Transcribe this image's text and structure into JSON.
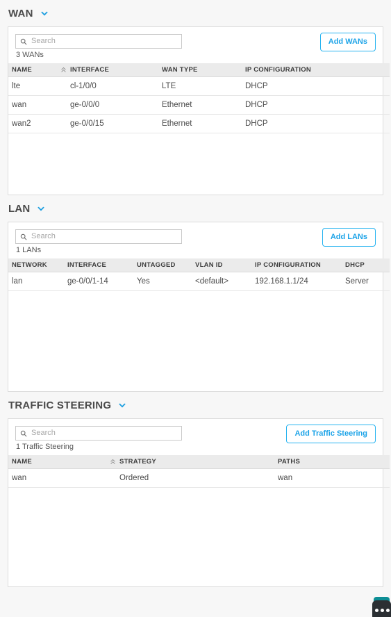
{
  "theme": {
    "accent": "#1ba3e8",
    "page_bg": "#f7f7f7",
    "card_bg": "#ffffff",
    "header_row_bg": "#ebebeb",
    "text": "#4a4a4a"
  },
  "sections": [
    {
      "key": "wan",
      "title": "WAN",
      "collapse_icon": "chevron-down-icon",
      "search": {
        "placeholder": "Search",
        "value": "",
        "icon": "search-icon"
      },
      "count_label": "3 WANs",
      "add_button": "Add WANs",
      "columns": [
        {
          "label": "NAME",
          "sorted": true,
          "sort_icon": "sort-ascending-icon"
        },
        {
          "label": "INTERFACE",
          "sorted": false
        },
        {
          "label": "WAN TYPE",
          "sorted": false
        },
        {
          "label": "IP CONFIGURATION",
          "sorted": false
        }
      ],
      "rows": [
        [
          "lte",
          "cl-1/0/0",
          "LTE",
          "DHCP"
        ],
        [
          "wan",
          "ge-0/0/0",
          "Ethernet",
          "DHCP"
        ],
        [
          "wan2",
          "ge-0/0/15",
          "Ethernet",
          "DHCP"
        ]
      ]
    },
    {
      "key": "lan",
      "title": "LAN",
      "collapse_icon": "chevron-down-icon",
      "search": {
        "placeholder": "Search",
        "value": "",
        "icon": "search-icon"
      },
      "count_label": "1 LANs",
      "add_button": "Add LANs",
      "columns": [
        {
          "label": "NETWORK",
          "sorted": false
        },
        {
          "label": "INTERFACE",
          "sorted": false
        },
        {
          "label": "UNTAGGED",
          "sorted": false
        },
        {
          "label": "VLAN ID",
          "sorted": false
        },
        {
          "label": "IP CONFIGURATION",
          "sorted": false
        },
        {
          "label": "DHCP",
          "sorted": false
        }
      ],
      "rows": [
        [
          "lan",
          "ge-0/0/1-14",
          "Yes",
          "<default>",
          "192.168.1.1/24",
          "Server"
        ]
      ]
    },
    {
      "key": "traffic_steering",
      "title": "TRAFFIC STEERING",
      "collapse_icon": "chevron-down-icon",
      "search": {
        "placeholder": "Search",
        "value": "",
        "icon": "search-icon"
      },
      "count_label": "1 Traffic Steering",
      "add_button": "Add Traffic Steering",
      "columns": [
        {
          "label": "NAME",
          "sorted": false
        },
        {
          "label": "STRATEGY",
          "sorted": true,
          "sort_icon": "sort-ascending-icon"
        },
        {
          "label": "PATHS",
          "sorted": false
        }
      ],
      "rows": [
        [
          "wan",
          "Ordered",
          "wan"
        ]
      ]
    }
  ],
  "chat_widget": {
    "name": "support-chat-widget",
    "cap_color": "#0d8e95",
    "body_color": "#2b2f33"
  }
}
